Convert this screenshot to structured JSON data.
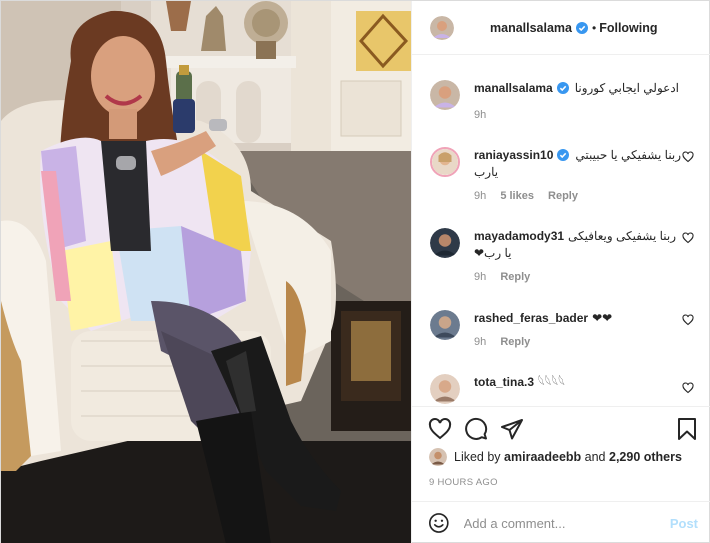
{
  "post": {
    "author": "manallsalama",
    "follow_label": "Following",
    "dot": "•",
    "caption": {
      "user": "manallsalama",
      "text": "ادعولي ايجابي كورونا",
      "time": "9h"
    },
    "comments": [
      {
        "user": "raniayassin10",
        "text": "ربنا يشفيكي يا حبيبتي يارب",
        "time": "9h",
        "likes": "5 likes",
        "reply": "Reply"
      },
      {
        "user": "mayadamody31",
        "text": "ربنا يشفيكى ويعافيكى يا رب❤",
        "time": "9h",
        "reply": "Reply"
      },
      {
        "user": "rashed_feras_bader",
        "text": "❤❤",
        "time": "9h",
        "reply": "Reply"
      },
      {
        "user": "tota_tina.3",
        "text": "𓆩𓆩𓆩𓆩"
      }
    ],
    "liked_by": {
      "prefix": "Liked by",
      "user": "amiraadeebb",
      "connector": "and",
      "others": "2,290 others"
    },
    "timestamp": "9 HOURS AGO",
    "add_comment": {
      "placeholder": "Add a comment...",
      "post_label": "Post"
    }
  },
  "icons": {
    "verified": "verified-badge-icon",
    "heart": "heart-icon",
    "comment": "comment-icon",
    "share": "share-icon",
    "save": "bookmark-icon",
    "emoji": "emoji-icon"
  },
  "colors": {
    "verified": "#3897f0",
    "post_disabled": "#b2dffc",
    "muted": "#8e8e8e"
  }
}
